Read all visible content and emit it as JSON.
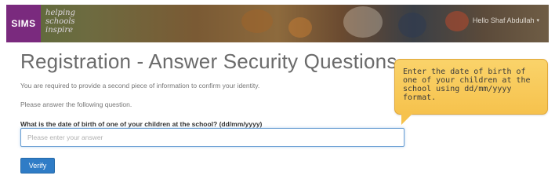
{
  "header": {
    "logo_text": "SIMS",
    "tagline_lines": [
      "helping",
      "schools",
      "inspire"
    ],
    "user_name": "Hello Shaf Abdullah"
  },
  "main": {
    "title": "Registration - Answer Security Questions",
    "info_line_1": "You are required to provide a second piece of information to confirm your identity.",
    "info_line_2": "Please answer the following question.",
    "question": "What is the date of birth of one of your children at the school? (dd/mm/yyyy)",
    "answer_placeholder": "Please enter your answer",
    "answer_value": "",
    "verify_label": "Verify"
  },
  "callout": {
    "text": "Enter the date of birth of one of your children at the school using dd/mm/yyyy format."
  }
}
